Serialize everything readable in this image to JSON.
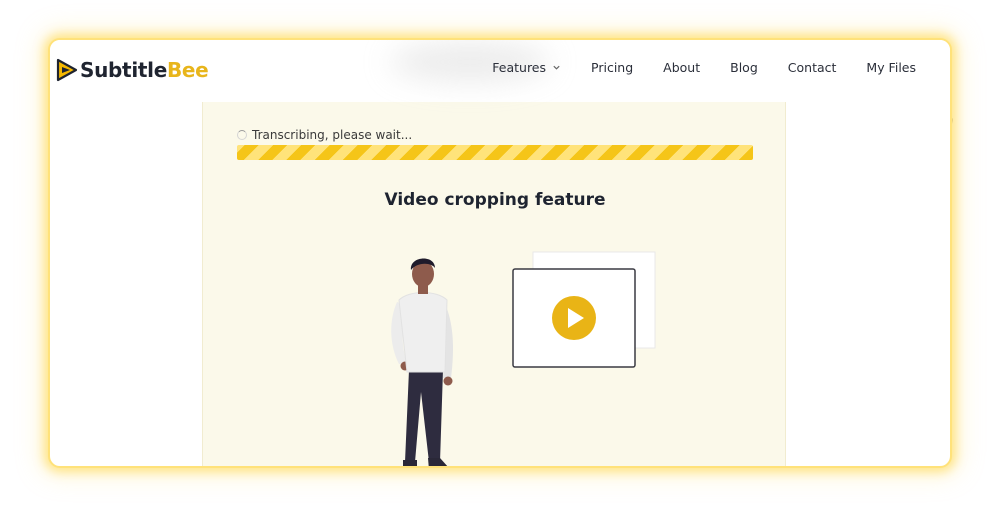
{
  "brand": {
    "name_part1": "Subtitle",
    "name_part2": "Bee",
    "logo_icon": "play-bee-logo-icon"
  },
  "nav": {
    "items": [
      {
        "label": "Features",
        "has_dropdown": true
      },
      {
        "label": "Pricing"
      },
      {
        "label": "About"
      },
      {
        "label": "Blog"
      },
      {
        "label": "Contact"
      },
      {
        "label": "My Files"
      }
    ]
  },
  "status": {
    "text": "Transcribing, please wait...",
    "progress_percent": 100
  },
  "feature": {
    "title": "Video cropping feature"
  },
  "colors": {
    "accent": "#e8b51b",
    "progress": "#f5c518",
    "panel_bg": "#fbf9ea",
    "text_dark": "#1e2430"
  },
  "icons": [
    "chevron-down-icon",
    "spinner-icon",
    "play-icon"
  ]
}
